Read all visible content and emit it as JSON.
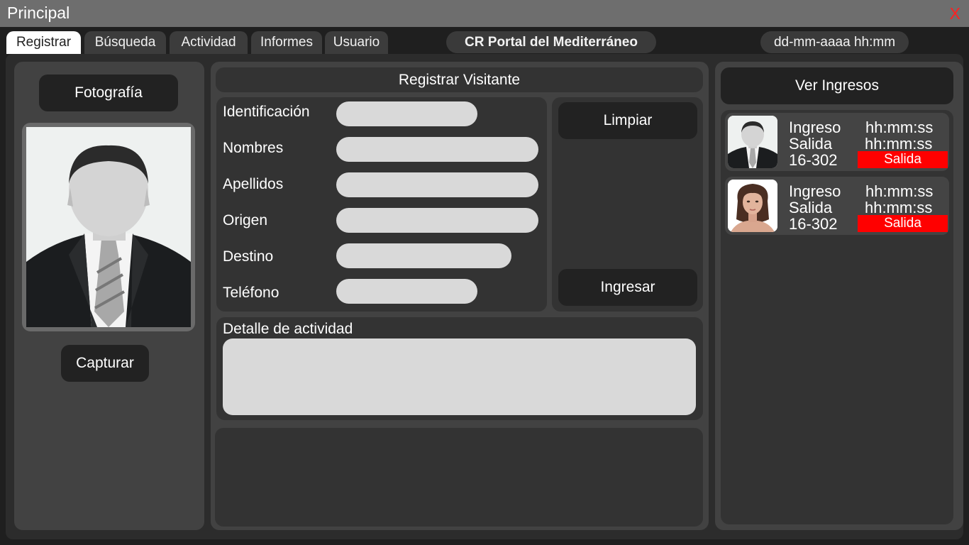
{
  "window": {
    "title": "Principal",
    "close_label": "X"
  },
  "tabs": [
    {
      "label": "Registrar",
      "active": true
    },
    {
      "label": "Búsqueda",
      "active": false
    },
    {
      "label": "Actividad",
      "active": false
    },
    {
      "label": "Informes",
      "active": false
    },
    {
      "label": "Usuario",
      "active": false
    }
  ],
  "header": {
    "location": "CR Portal del Mediterráneo",
    "datetime": "dd-mm-aaaa hh:mm"
  },
  "photo_panel": {
    "photo_label": "Fotografía",
    "capture_label": "Capturar"
  },
  "form": {
    "title": "Registrar Visitante",
    "fields": [
      {
        "label": "Identificación",
        "value": ""
      },
      {
        "label": "Nombres",
        "value": ""
      },
      {
        "label": "Apellidos",
        "value": ""
      },
      {
        "label": "Origen",
        "value": ""
      },
      {
        "label": "Destino",
        "value": ""
      },
      {
        "label": "Teléfono",
        "value": ""
      }
    ],
    "clear_label": "Limpiar",
    "submit_label": "Ingresar",
    "activity_label": "Detalle de actividad",
    "activity_value": ""
  },
  "entries_panel": {
    "title": "Ver Ingresos",
    "entries": [
      {
        "photo": "male-visitor-photo",
        "in_label": "Ingreso",
        "in_time": "hh:mm:ss",
        "out_label": "Salida",
        "out_time": "hh:mm:ss",
        "unit": "16-302",
        "action": "Salida"
      },
      {
        "photo": "female-visitor-photo",
        "in_label": "Ingreso",
        "in_time": "hh:mm:ss",
        "out_label": "Salida",
        "out_time": "hh:mm:ss",
        "unit": "16-302",
        "action": "Salida"
      }
    ]
  },
  "colors": {
    "accent_red": "#ff0000",
    "field_bg": "#d9d9d9",
    "panel_bg": "#424242",
    "button_bg": "#222222"
  }
}
